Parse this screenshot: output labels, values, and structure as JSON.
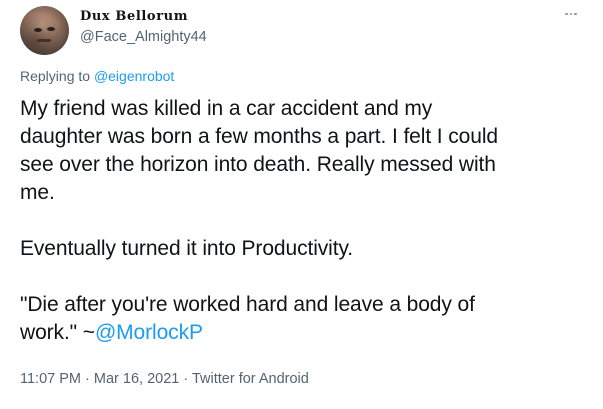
{
  "author": {
    "display_name": "Dux Bellorum",
    "handle": "@Face_Almighty44"
  },
  "reply": {
    "prefix": "Replying to ",
    "mention": "@eigenrobot"
  },
  "tweet": {
    "paragraph1_line1": "My friend was killed in a car accident and my",
    "paragraph1_line2": "daughter was born a few months a part. I felt I could",
    "paragraph1_line3": "see over the horizon into death. Really messed with",
    "paragraph1_line4": "me.",
    "paragraph2": "Eventually turned it into Productivity.",
    "paragraph3_line1": "\"Die after you're worked hard and leave a body of",
    "paragraph3_line2_text": "work.\" ~",
    "paragraph3_mention": "@MorlockP"
  },
  "meta": {
    "time": "11:07 PM",
    "separator1": " · ",
    "date": "Mar 16, 2021",
    "separator2": " · ",
    "client": "Twitter for Android"
  },
  "icons": {
    "more": "more-horizontal-icon"
  },
  "colors": {
    "accent": "#1d9bf0",
    "text": "#0f1419",
    "muted": "#536471"
  }
}
